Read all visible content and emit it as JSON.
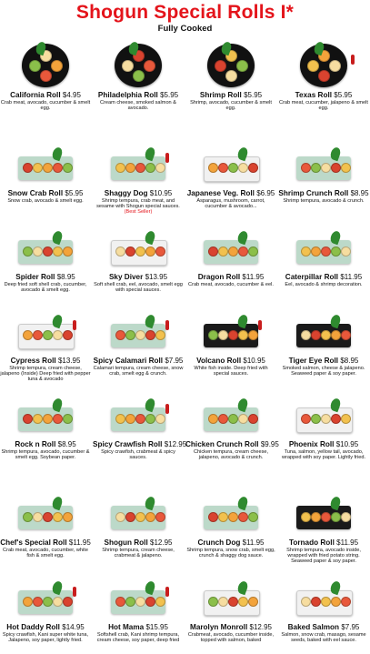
{
  "header": {
    "title": "Shogun Special Rolls I*",
    "subtitle": "Fully Cooked"
  },
  "items": [
    {
      "name": "California Roll",
      "price": "$4.95",
      "desc": "Crab meat, avocado, cucumber & smelt egg.",
      "plate": "round"
    },
    {
      "name": "Philadelphia Roll",
      "price": "$5.95",
      "desc": "Cream cheese, smoked salmon & avocado.",
      "plate": "round"
    },
    {
      "name": "Shrimp Roll",
      "price": "$5.95",
      "desc": "Shrimp, avocado, cucumber & smelt egg.",
      "plate": "round"
    },
    {
      "name": "Texas Roll",
      "price": "$5.95",
      "desc": "Crab meat, cucumber, jalapeno & smelt egg.",
      "plate": "round"
    },
    {
      "name": "Snow Crab Roll",
      "price": "$5.95",
      "desc": "Snow crab, avocado & smelt egg.",
      "plate": "rect"
    },
    {
      "name": "Shaggy Dog",
      "price": "$10.95",
      "desc": "Shrimp tempura, crab meat, and sesame with Shogun special sauces.",
      "note": "(Best Seller)",
      "plate": "rect"
    },
    {
      "name": "Japanese Veg. Roll",
      "price": "$6.95",
      "desc": "Asparagus, mushroom, carrot, cucumber & avocado...",
      "plate": "white"
    },
    {
      "name": "Shrimp Crunch Roll",
      "price": "$8.95",
      "desc": "Shrimp tempura, avocado & crunch.",
      "plate": "rect"
    },
    {
      "name": "Spider Roll",
      "price": "$8.95",
      "desc": "Deep fried soft shell crab, cucumber, avocado & smelt egg.",
      "plate": "rect"
    },
    {
      "name": "Sky Diver",
      "price": "$13.95",
      "desc": "Soft shell crab, eel, avocado, smelt egg with special sauces.",
      "plate": "white"
    },
    {
      "name": "Dragon Roll",
      "price": "$11.95",
      "desc": "Crab meat, avocado, cucumber & eel.",
      "plate": "rect"
    },
    {
      "name": "Caterpillar Roll",
      "price": "$11.95",
      "desc": "Eel, avocado & shrimp decoration.",
      "plate": "rect"
    },
    {
      "name": "Cypress Roll",
      "price": "$13.95",
      "desc": "Shrimp tempura, cream cheese, jalapeno (Inside) Deep fried with pepper tuna & avocado",
      "plate": "white"
    },
    {
      "name": "Spicy Calamari Roll",
      "price": "$7.95",
      "desc": "Calamari tempura, cream cheese, snow crab, smelt egg & crunch.",
      "plate": "rect"
    },
    {
      "name": "Volcano Roll",
      "price": "$10.95",
      "desc": "White fish inside. Deep fried with special sauces.",
      "plate": "dark"
    },
    {
      "name": "Tiger Eye Roll",
      "price": "$8.95",
      "desc": "Smoked salmon, cheese & jalapeno. Seaweed paper & soy paper.",
      "plate": "dark"
    },
    {
      "name": "Rock n Roll",
      "price": "$8.95",
      "desc": "Shrimp tempura, avocado, cucumber & smelt egg. Soybean paper.",
      "plate": "rect"
    },
    {
      "name": "Spicy Crawfish Roll",
      "price": "$12.95",
      "desc": "Spicy crawfish, crabmeat & spicy sauces.",
      "plate": "rect"
    },
    {
      "name": "Chicken Crunch Roll",
      "price": "$9.95",
      "desc": "Chicken tempura, cream cheese, jalapeno, avocado & crunch.",
      "plate": "rect"
    },
    {
      "name": "Phoenix Roll",
      "price": "$10.95",
      "desc": "Tuna, salmon, yellow tail, avocado, wrapped with soy paper. Lightly fried.",
      "plate": "white"
    },
    {
      "name": "Chef's Special Roll",
      "price": "$11.95",
      "desc": "Crab meat, avocado, cucumber, white fish & smelt egg.",
      "plate": "rect"
    },
    {
      "name": "Shogun Roll",
      "price": "$12.95",
      "desc": "Shrimp tempura, cream cheese, crabmeat & jalapeno.",
      "plate": "rect"
    },
    {
      "name": "Crunch Dog",
      "price": "$11.95",
      "desc": "Shrimp tempura, snow crab, smelt egg, crunch & shaggy dog sauce.",
      "plate": "rect"
    },
    {
      "name": "Tornado Roll",
      "price": "$11.95",
      "desc": "Shrimp tempura, avocado inside, wrapped with fried potato string. Seaweed paper & soy paper.",
      "plate": "dark"
    },
    {
      "name": "Hot Daddy Roll",
      "price": "$14.95",
      "desc": "Spicy crawfish, Kani super white tuna, Jalapeno, soy paper, lightly fried.",
      "plate": "rect"
    },
    {
      "name": "Hot Mama",
      "price": "$15.95",
      "desc": "Softshell crab, Kani shrimp tempura, cream cheese, soy paper, deep fried",
      "plate": "rect"
    },
    {
      "name": "Marolyn Monroll",
      "price": "$12.95",
      "desc": "Crabmeat, avocado, cucumber inside, topped with salmon, baked",
      "plate": "white"
    },
    {
      "name": "Baked Salmon",
      "price": "$7.95",
      "desc": "Salmon, snow crab, masago, sesame seeds, baked with eel sauce.",
      "plate": "white"
    }
  ]
}
